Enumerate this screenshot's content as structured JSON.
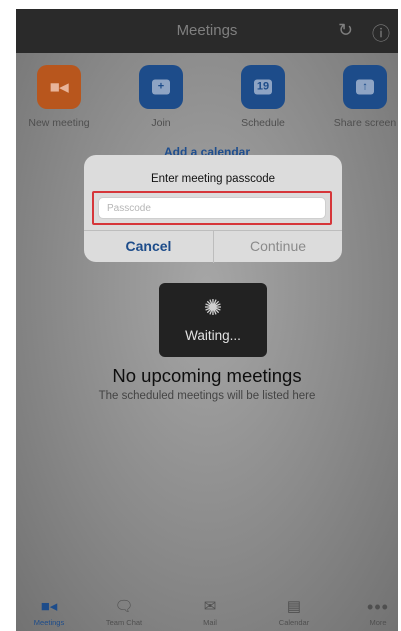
{
  "header": {
    "title": "Meetings",
    "refresh_icon": "refresh-icon",
    "info_icon": "info-icon"
  },
  "actions": [
    {
      "label": "New meeting",
      "icon": "video-camera-icon",
      "color": "#b8561d"
    },
    {
      "label": "Join",
      "icon": "plus-icon",
      "color": "#1d4c8a"
    },
    {
      "label": "Schedule",
      "icon": "calendar-icon",
      "date": "19",
      "color": "#1d4c8a"
    },
    {
      "label": "Share screen",
      "icon": "share-up-icon",
      "color": "#1d4c8a"
    }
  ],
  "add_calendar": "Add a calendar",
  "dialog": {
    "title": "Enter meeting passcode",
    "placeholder": "Passcode",
    "value": "",
    "cancel": "Cancel",
    "continue": "Continue",
    "highlight_color": "#d6363a"
  },
  "loading": {
    "text": "Waiting..."
  },
  "empty_state": {
    "title": "No upcoming meetings",
    "subtitle": "The scheduled meetings will be listed here"
  },
  "tabs": [
    {
      "label": "Meetings",
      "icon": "video-camera-icon",
      "active": true
    },
    {
      "label": "Team Chat",
      "icon": "chat-bubbles-icon",
      "active": false
    },
    {
      "label": "Mail",
      "icon": "mail-icon",
      "active": false
    },
    {
      "label": "Calendar",
      "icon": "calendar-icon",
      "active": false
    },
    {
      "label": "More",
      "icon": "more-dots-icon",
      "active": false
    }
  ],
  "colors": {
    "accent": "#1d4c8a",
    "new_meeting": "#b8561d",
    "overlay_header": "#2a2a2a"
  }
}
